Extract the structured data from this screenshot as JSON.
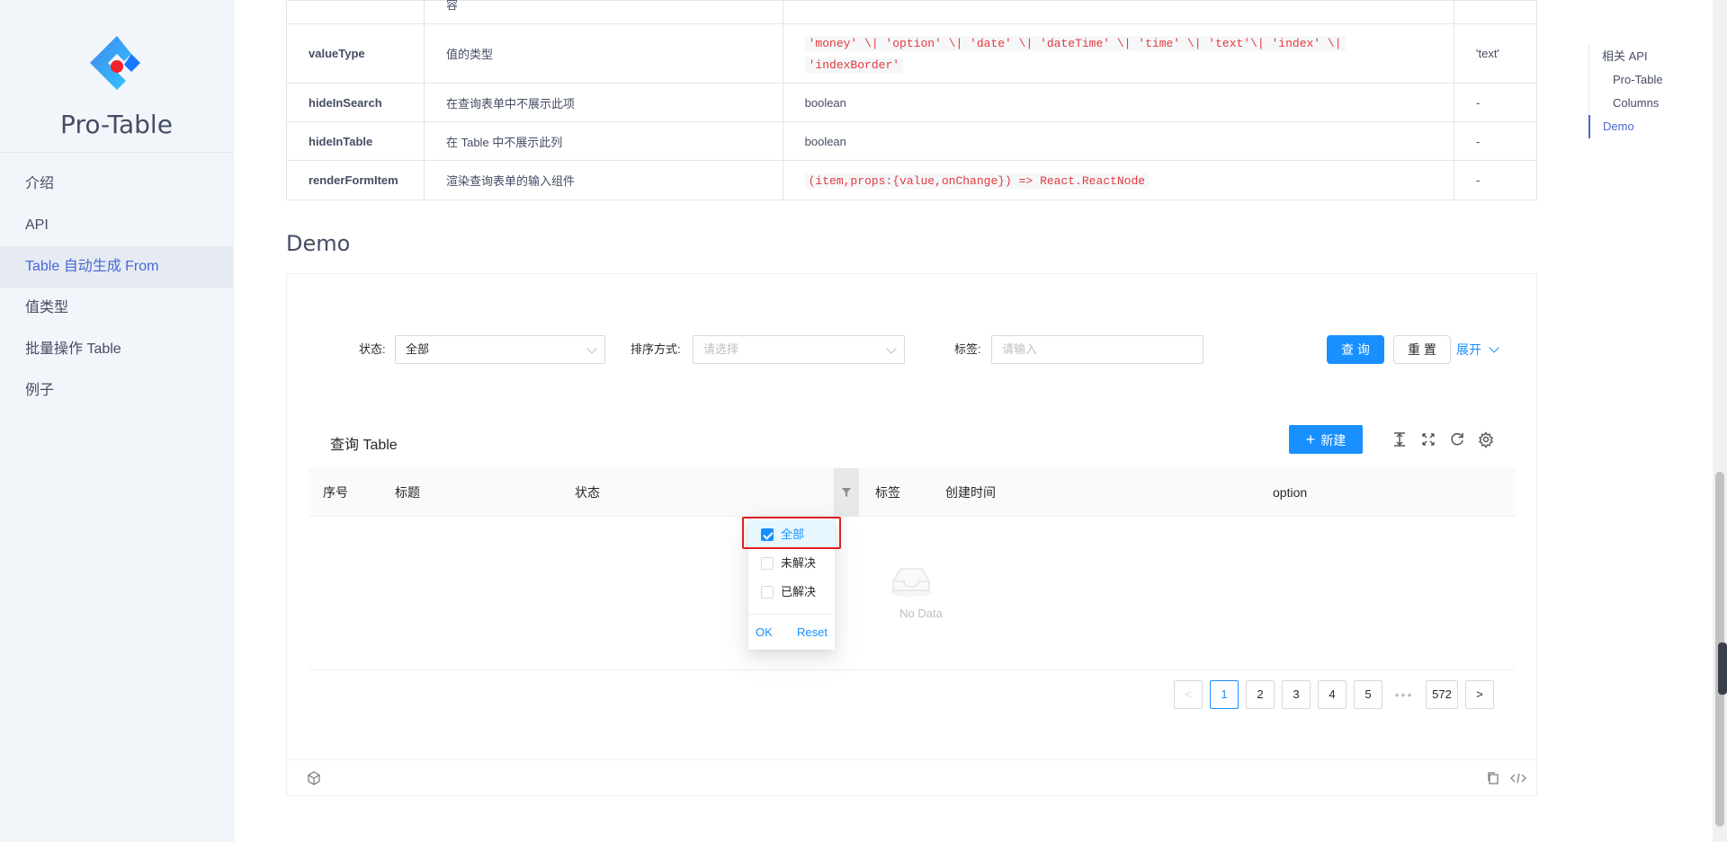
{
  "sidebar": {
    "title": "Pro-Table",
    "items": [
      {
        "label": "介绍"
      },
      {
        "label": "API"
      },
      {
        "label": "Table 自动生成 From"
      },
      {
        "label": "值类型"
      },
      {
        "label": "批量操作 Table"
      },
      {
        "label": "例子"
      }
    ]
  },
  "api_table": {
    "top_fragment": "容",
    "rows": [
      {
        "name": "valueType",
        "desc": "值的类型",
        "type_line1": "'money' \\| 'option' \\| 'date' \\| 'dateTime' \\| 'time' \\| 'text'\\| 'index' \\|",
        "type_line2": "'indexBorder'",
        "default": "'text'"
      },
      {
        "name": "hideInSearch",
        "desc": "在查询表单中不展示此项",
        "type": "boolean",
        "default": "-"
      },
      {
        "name": "hideInTable",
        "desc": "在 Table 中不展示此列",
        "type": "boolean",
        "default": "-"
      },
      {
        "name": "renderFormItem",
        "desc": "渲染查询表单的输入组件",
        "type": "(item,props:{value,onChange}) => React.ReactNode",
        "default": "-"
      }
    ]
  },
  "demo": {
    "heading": "Demo",
    "form": {
      "status_label": "状态:",
      "status_value": "全部",
      "sort_label": "排序方式:",
      "sort_placeholder": "请选择",
      "tag_label": "标签:",
      "tag_placeholder": "请输入",
      "query_button": "查 询",
      "reset_button": "重 置",
      "expand_link": "展开"
    },
    "toolbar": {
      "title": "查询 Table",
      "new_button": "新建"
    },
    "columns": [
      "序号",
      "标题",
      "状态",
      "标签",
      "创建时间",
      "option"
    ],
    "empty_text": "No Data",
    "filter_dropdown": {
      "options": [
        {
          "label": "全部",
          "checked": true
        },
        {
          "label": "未解决",
          "checked": false
        },
        {
          "label": "已解决",
          "checked": false
        }
      ],
      "ok": "OK",
      "reset": "Reset"
    },
    "pagination": {
      "pages": [
        "1",
        "2",
        "3",
        "4",
        "5"
      ],
      "ellipsis": "•••",
      "last": "572",
      "current": "1",
      "prev": "<",
      "next": ">"
    }
  },
  "toc": {
    "items": [
      {
        "label": "相关 API",
        "level": 1
      },
      {
        "label": "Pro-Table",
        "level": 2
      },
      {
        "label": "Columns",
        "level": 2
      },
      {
        "label": "Demo",
        "level": 1,
        "active": true
      }
    ]
  },
  "colors": {
    "primary": "#1890ff",
    "sidebar_bg": "#f2f5fa",
    "highlight": "#e02020"
  }
}
